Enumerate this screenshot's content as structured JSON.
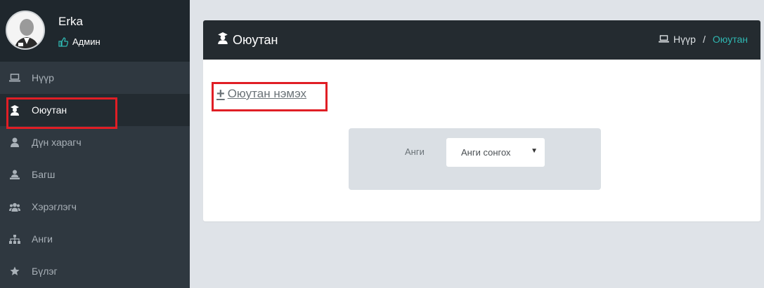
{
  "profile": {
    "name": "Erka",
    "role": "Админ"
  },
  "sidebar": {
    "items": [
      {
        "label": "Нүүр",
        "icon": "laptop-icon"
      },
      {
        "label": "Оюутан",
        "icon": "student-icon",
        "active": true
      },
      {
        "label": "Дүн харагч",
        "icon": "user-icon"
      },
      {
        "label": "Багш",
        "icon": "teacher-icon"
      },
      {
        "label": "Хэрэглэгч",
        "icon": "users-icon"
      },
      {
        "label": "Анги",
        "icon": "sitemap-icon"
      },
      {
        "label": "Бүлэг",
        "icon": "star-icon"
      }
    ]
  },
  "panel": {
    "title": "Оюутан",
    "breadcrumb": {
      "home": "Нүүр",
      "separator": "/",
      "current": "Оюутан"
    },
    "add_link": "Оюутан нэмэх",
    "filter": {
      "label": "Анги",
      "select_value": "Анги сонгох"
    }
  },
  "colors": {
    "accent": "#2fb7b1",
    "highlight": "#e01e25",
    "sidebar": "#2f3840",
    "header": "#242b30"
  }
}
